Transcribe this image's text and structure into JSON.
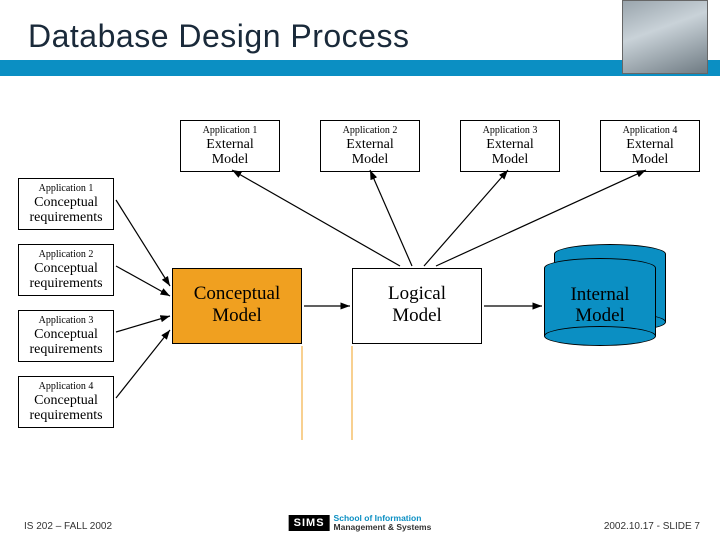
{
  "title": "Database Design Process",
  "left_boxes": [
    {
      "app": "Application 1",
      "line1": "Conceptual",
      "line2": "requirements"
    },
    {
      "app": "Application 2",
      "line1": "Conceptual",
      "line2": "requirements"
    },
    {
      "app": "Application 3",
      "line1": "Conceptual",
      "line2": "requirements"
    },
    {
      "app": "Application 4",
      "line1": "Conceptual",
      "line2": "requirements"
    }
  ],
  "ext_boxes": [
    {
      "app": "Application 1",
      "line1": "External",
      "line2": "Model"
    },
    {
      "app": "Application 2",
      "line1": "External",
      "line2": "Model"
    },
    {
      "app": "Application 3",
      "line1": "External",
      "line2": "Model"
    },
    {
      "app": "Application 4",
      "line1": "External",
      "line2": "Model"
    }
  ],
  "conceptual": {
    "line1": "Conceptual",
    "line2": "Model"
  },
  "logical": {
    "line1": "Logical",
    "line2": "Model"
  },
  "internal": {
    "line1": "Internal",
    "line2": "Model"
  },
  "footer": {
    "left": "IS 202 – FALL 2002",
    "center_mark": "SIMS",
    "center_sub1": "School of Information",
    "center_sub2": "Management & Systems",
    "right": "2002.10.17 - SLIDE 7"
  }
}
